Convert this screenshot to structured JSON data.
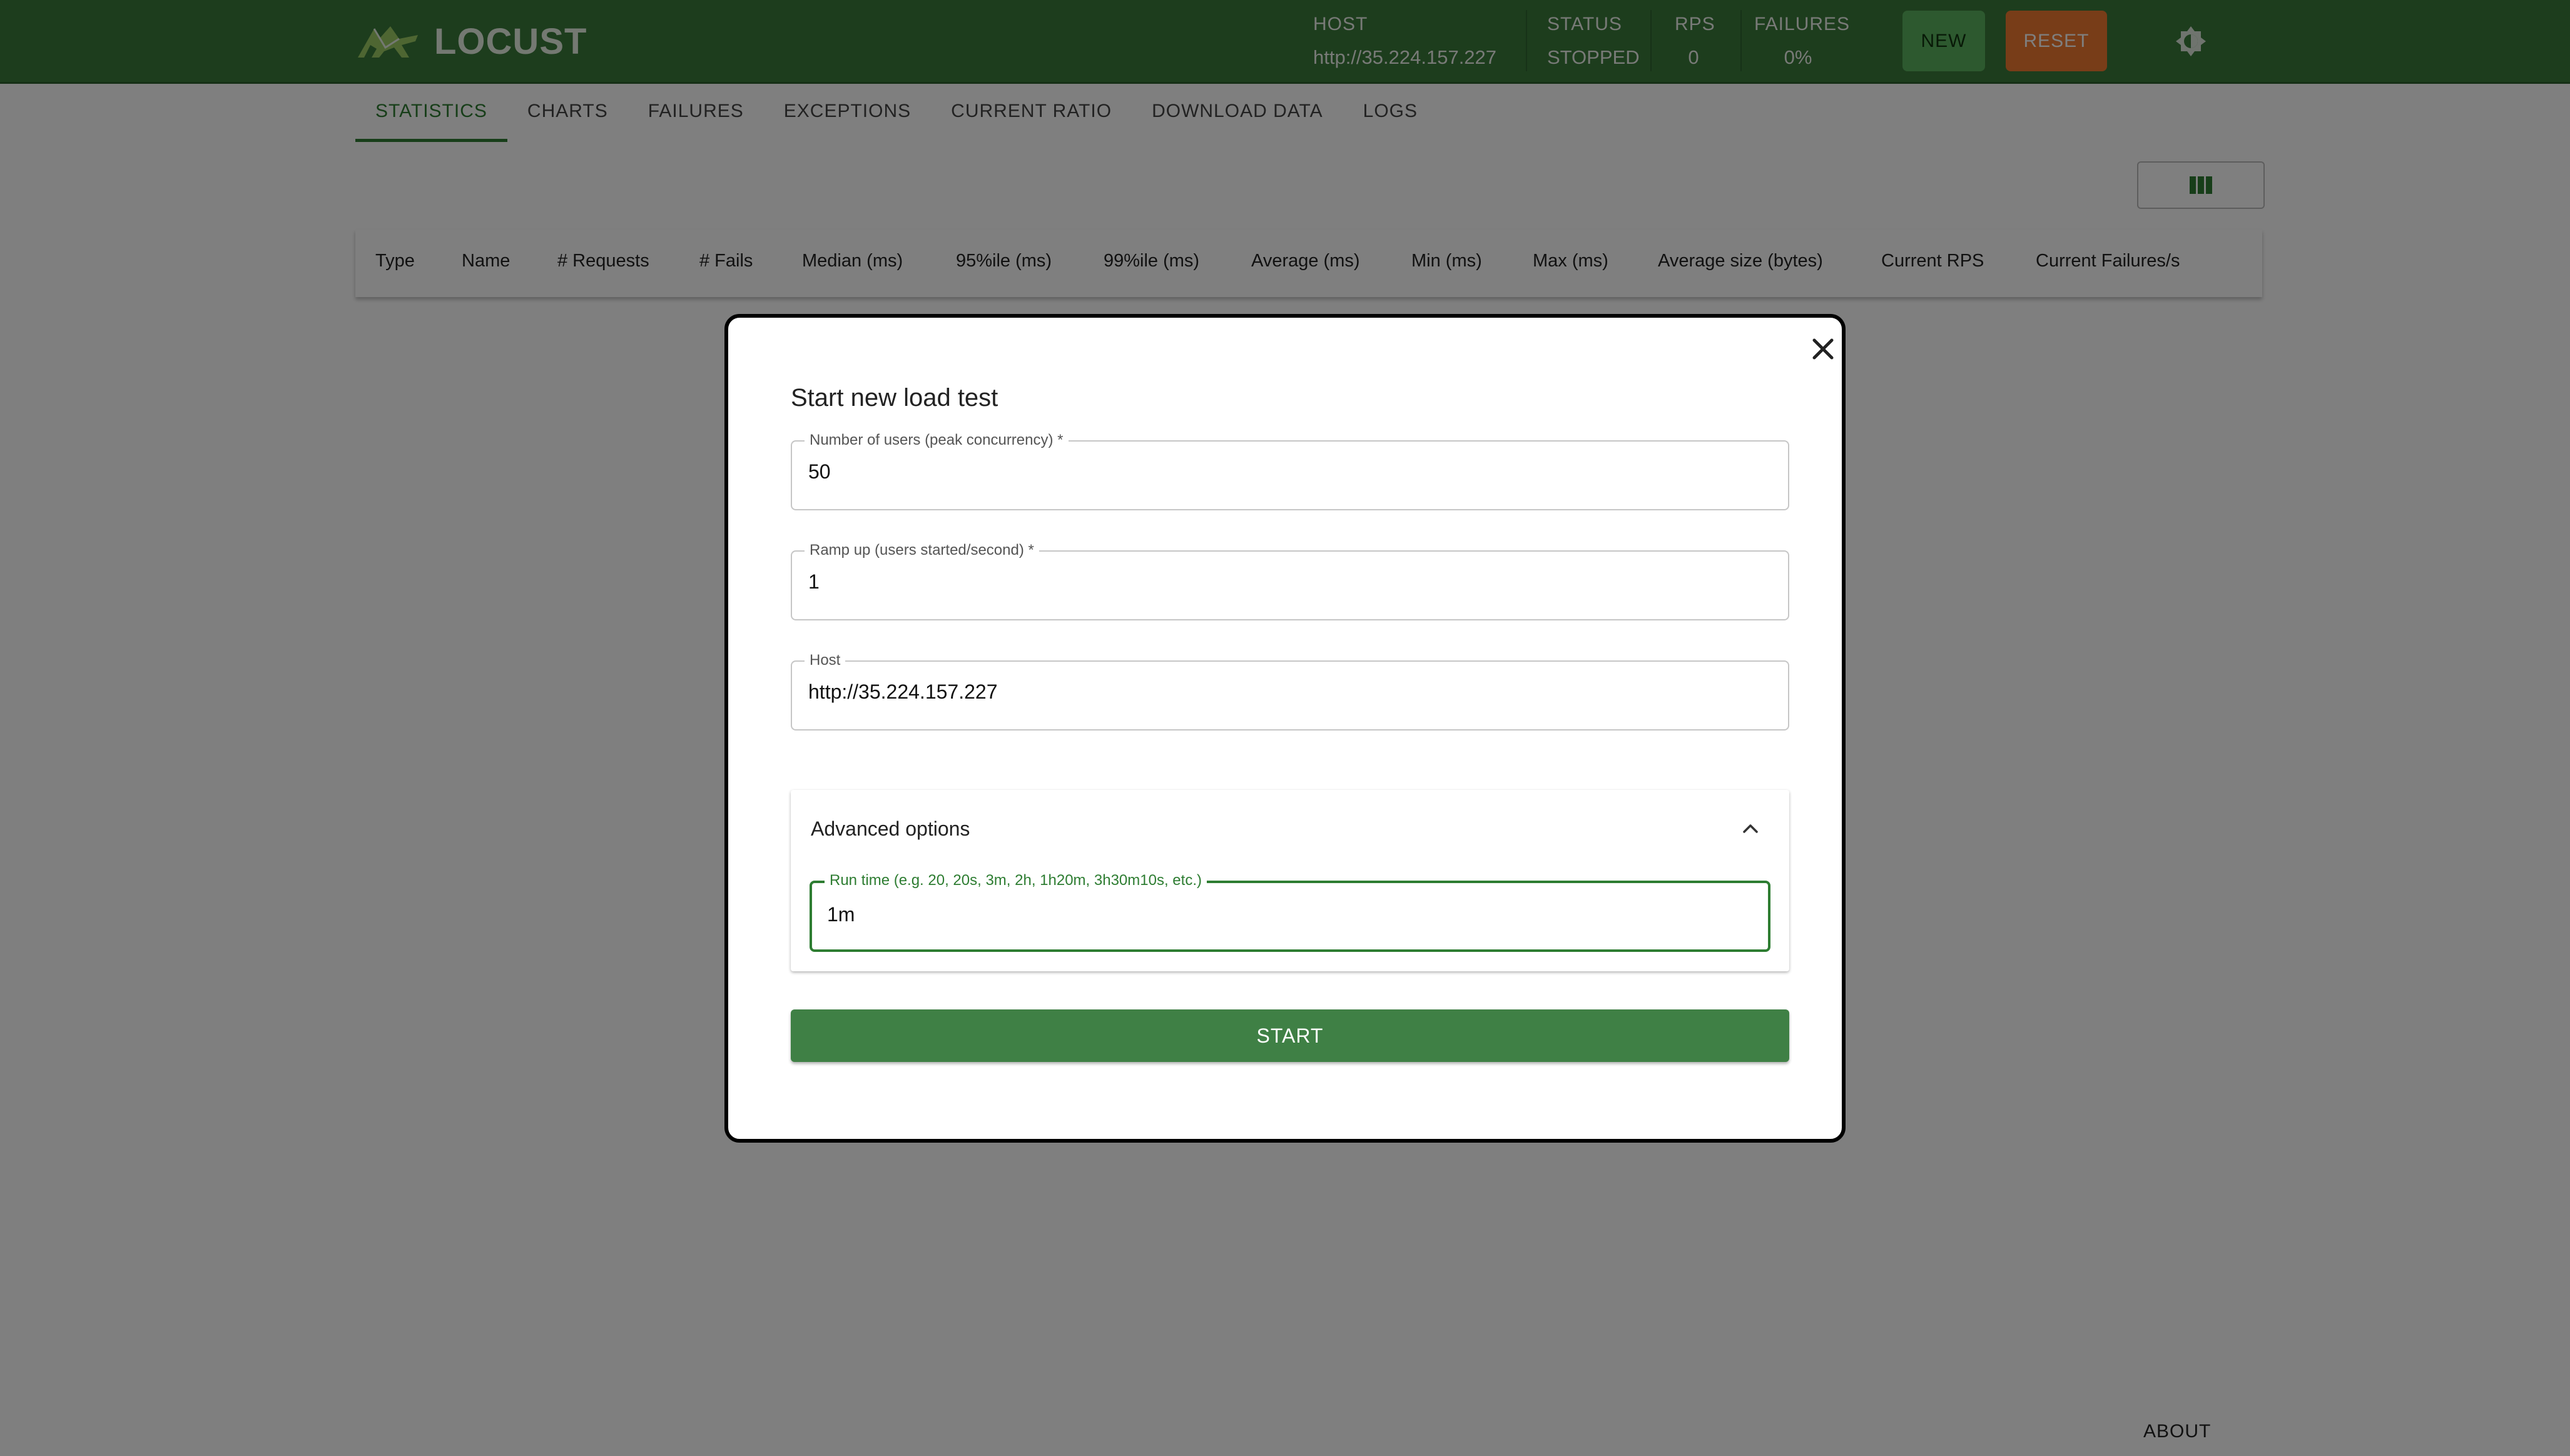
{
  "app": {
    "name": "LOCUST"
  },
  "stats": {
    "host_label": "HOST",
    "host_value": "http://35.224.157.227",
    "status_label": "STATUS",
    "status_value": "STOPPED",
    "rps_label": "RPS",
    "rps_value": "0",
    "failures_label": "FAILURES",
    "failures_value": "0%"
  },
  "buttons": {
    "new": "NEW",
    "reset": "RESET"
  },
  "tabs": [
    "STATISTICS",
    "CHARTS",
    "FAILURES",
    "EXCEPTIONS",
    "CURRENT RATIO",
    "DOWNLOAD DATA",
    "LOGS"
  ],
  "table": {
    "headers": [
      "Type",
      "Name",
      "# Requests",
      "# Fails",
      "Median (ms)",
      "95%ile (ms)",
      "99%ile (ms)",
      "Average (ms)",
      "Min (ms)",
      "Max (ms)",
      "Average size (bytes)",
      "Current RPS",
      "Current Failures/s"
    ]
  },
  "footer": {
    "about": "ABOUT"
  },
  "modal": {
    "title": "Start new load test",
    "users": {
      "label": "Number of users (peak concurrency) *",
      "value": "50"
    },
    "ramp": {
      "label": "Ramp up (users started/second) *",
      "value": "1"
    },
    "host": {
      "label": "Host",
      "value": "http://35.224.157.227"
    },
    "advanced": {
      "title": "Advanced options",
      "runtime": {
        "label": "Run time (e.g. 20, 20s, 3m, 2h, 1h20m, 3h30m10s, etc.)",
        "value": "1m"
      }
    },
    "start": "START"
  },
  "colors": {
    "brand": "#3a7a3b",
    "accent": "#2e7d32",
    "new": "#5bb35f",
    "reset": "#f07a30"
  },
  "icons": {
    "theme": "brightness-icon",
    "columns": "view-column-icon",
    "close": "close-icon",
    "advanced": "chevron-up-icon"
  }
}
